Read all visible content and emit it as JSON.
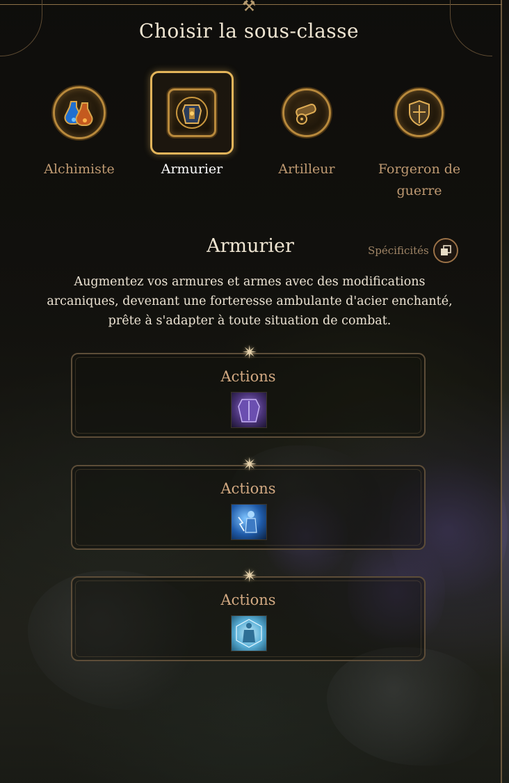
{
  "header": {
    "crest_icon": "crossed-hammers-icon",
    "title": "Choisir la sous-classe"
  },
  "subclasses": [
    {
      "label": "Alchimiste",
      "icon": "potion-flasks-icon",
      "selected": false
    },
    {
      "label": "Armurier",
      "icon": "armor-emblem-icon",
      "selected": true
    },
    {
      "label": "Artilleur",
      "icon": "cannon-icon",
      "selected": false
    },
    {
      "label": "Forgeron de guerre",
      "label_line1": "Forgeron de",
      "label_line2": "guerre",
      "icon": "shield-helmet-icon",
      "selected": false
    }
  ],
  "detail": {
    "title": "Armurier",
    "specs_label": "Spécificités",
    "specs_icon": "stacked-windows-icon",
    "description": "Augmentez vos armures et armes avec des modifications arcaniques, devenant une forteresse ambulante d'acier enchanté, prête à s'adapter à toute situation de combat."
  },
  "cards": [
    {
      "label": "Actions",
      "icon": "purple-armor-icon",
      "accent": "#6a4fa8"
    },
    {
      "label": "Actions",
      "icon": "lightning-figure-icon",
      "accent": "#2b7fd1"
    },
    {
      "label": "Actions",
      "icon": "blueprint-armor-icon",
      "accent": "#5ab0d8"
    }
  ],
  "colors": {
    "selected_border": "#e2b45a",
    "label_gold": "#bf9a72",
    "title_text": "#efe5d2"
  }
}
